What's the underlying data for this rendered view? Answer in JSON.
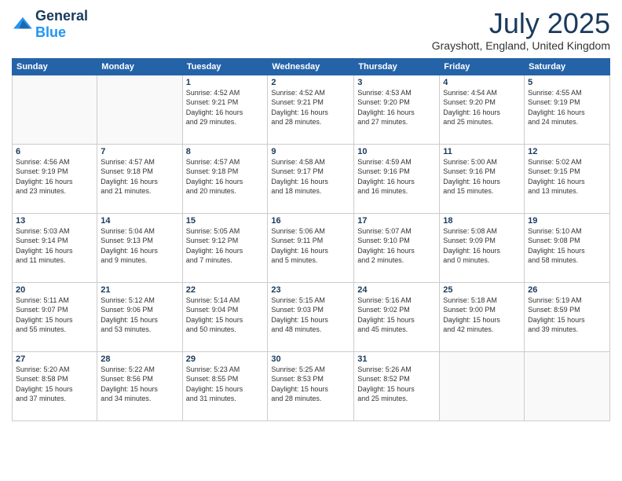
{
  "header": {
    "logo": {
      "general": "General",
      "blue": "Blue"
    },
    "title": "July 2025",
    "location": "Grayshott, England, United Kingdom"
  },
  "days_of_week": [
    "Sunday",
    "Monday",
    "Tuesday",
    "Wednesday",
    "Thursday",
    "Friday",
    "Saturday"
  ],
  "weeks": [
    [
      {
        "day": "",
        "info": ""
      },
      {
        "day": "",
        "info": ""
      },
      {
        "day": "1",
        "info": "Sunrise: 4:52 AM\nSunset: 9:21 PM\nDaylight: 16 hours\nand 29 minutes."
      },
      {
        "day": "2",
        "info": "Sunrise: 4:52 AM\nSunset: 9:21 PM\nDaylight: 16 hours\nand 28 minutes."
      },
      {
        "day": "3",
        "info": "Sunrise: 4:53 AM\nSunset: 9:20 PM\nDaylight: 16 hours\nand 27 minutes."
      },
      {
        "day": "4",
        "info": "Sunrise: 4:54 AM\nSunset: 9:20 PM\nDaylight: 16 hours\nand 25 minutes."
      },
      {
        "day": "5",
        "info": "Sunrise: 4:55 AM\nSunset: 9:19 PM\nDaylight: 16 hours\nand 24 minutes."
      }
    ],
    [
      {
        "day": "6",
        "info": "Sunrise: 4:56 AM\nSunset: 9:19 PM\nDaylight: 16 hours\nand 23 minutes."
      },
      {
        "day": "7",
        "info": "Sunrise: 4:57 AM\nSunset: 9:18 PM\nDaylight: 16 hours\nand 21 minutes."
      },
      {
        "day": "8",
        "info": "Sunrise: 4:57 AM\nSunset: 9:18 PM\nDaylight: 16 hours\nand 20 minutes."
      },
      {
        "day": "9",
        "info": "Sunrise: 4:58 AM\nSunset: 9:17 PM\nDaylight: 16 hours\nand 18 minutes."
      },
      {
        "day": "10",
        "info": "Sunrise: 4:59 AM\nSunset: 9:16 PM\nDaylight: 16 hours\nand 16 minutes."
      },
      {
        "day": "11",
        "info": "Sunrise: 5:00 AM\nSunset: 9:16 PM\nDaylight: 16 hours\nand 15 minutes."
      },
      {
        "day": "12",
        "info": "Sunrise: 5:02 AM\nSunset: 9:15 PM\nDaylight: 16 hours\nand 13 minutes."
      }
    ],
    [
      {
        "day": "13",
        "info": "Sunrise: 5:03 AM\nSunset: 9:14 PM\nDaylight: 16 hours\nand 11 minutes."
      },
      {
        "day": "14",
        "info": "Sunrise: 5:04 AM\nSunset: 9:13 PM\nDaylight: 16 hours\nand 9 minutes."
      },
      {
        "day": "15",
        "info": "Sunrise: 5:05 AM\nSunset: 9:12 PM\nDaylight: 16 hours\nand 7 minutes."
      },
      {
        "day": "16",
        "info": "Sunrise: 5:06 AM\nSunset: 9:11 PM\nDaylight: 16 hours\nand 5 minutes."
      },
      {
        "day": "17",
        "info": "Sunrise: 5:07 AM\nSunset: 9:10 PM\nDaylight: 16 hours\nand 2 minutes."
      },
      {
        "day": "18",
        "info": "Sunrise: 5:08 AM\nSunset: 9:09 PM\nDaylight: 16 hours\nand 0 minutes."
      },
      {
        "day": "19",
        "info": "Sunrise: 5:10 AM\nSunset: 9:08 PM\nDaylight: 15 hours\nand 58 minutes."
      }
    ],
    [
      {
        "day": "20",
        "info": "Sunrise: 5:11 AM\nSunset: 9:07 PM\nDaylight: 15 hours\nand 55 minutes."
      },
      {
        "day": "21",
        "info": "Sunrise: 5:12 AM\nSunset: 9:06 PM\nDaylight: 15 hours\nand 53 minutes."
      },
      {
        "day": "22",
        "info": "Sunrise: 5:14 AM\nSunset: 9:04 PM\nDaylight: 15 hours\nand 50 minutes."
      },
      {
        "day": "23",
        "info": "Sunrise: 5:15 AM\nSunset: 9:03 PM\nDaylight: 15 hours\nand 48 minutes."
      },
      {
        "day": "24",
        "info": "Sunrise: 5:16 AM\nSunset: 9:02 PM\nDaylight: 15 hours\nand 45 minutes."
      },
      {
        "day": "25",
        "info": "Sunrise: 5:18 AM\nSunset: 9:00 PM\nDaylight: 15 hours\nand 42 minutes."
      },
      {
        "day": "26",
        "info": "Sunrise: 5:19 AM\nSunset: 8:59 PM\nDaylight: 15 hours\nand 39 minutes."
      }
    ],
    [
      {
        "day": "27",
        "info": "Sunrise: 5:20 AM\nSunset: 8:58 PM\nDaylight: 15 hours\nand 37 minutes."
      },
      {
        "day": "28",
        "info": "Sunrise: 5:22 AM\nSunset: 8:56 PM\nDaylight: 15 hours\nand 34 minutes."
      },
      {
        "day": "29",
        "info": "Sunrise: 5:23 AM\nSunset: 8:55 PM\nDaylight: 15 hours\nand 31 minutes."
      },
      {
        "day": "30",
        "info": "Sunrise: 5:25 AM\nSunset: 8:53 PM\nDaylight: 15 hours\nand 28 minutes."
      },
      {
        "day": "31",
        "info": "Sunrise: 5:26 AM\nSunset: 8:52 PM\nDaylight: 15 hours\nand 25 minutes."
      },
      {
        "day": "",
        "info": ""
      },
      {
        "day": "",
        "info": ""
      }
    ]
  ]
}
